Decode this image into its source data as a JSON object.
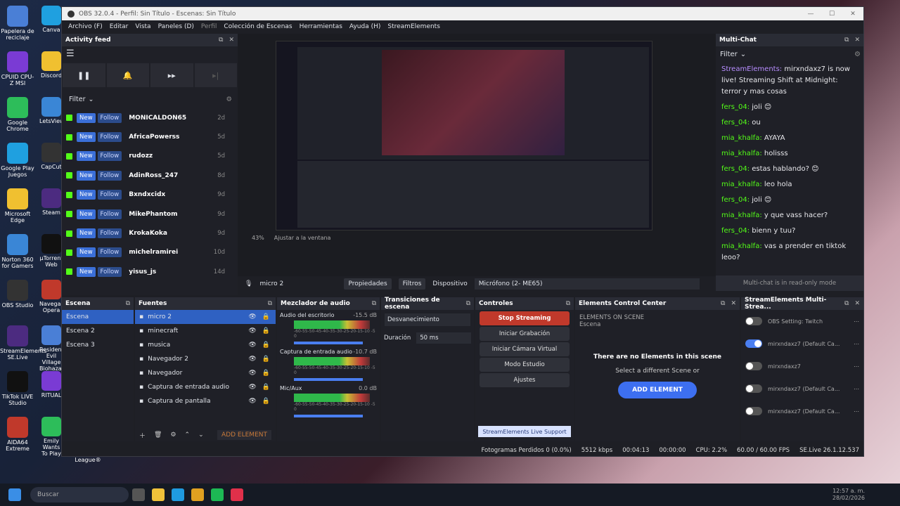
{
  "window": {
    "title": "OBS 32.0.4 - Perfil: Sin Título - Escenas: Sin Título"
  },
  "menu": [
    "Archivo (F)",
    "Editar",
    "Vista",
    "Paneles (D)",
    "Perfil",
    "Colección de Escenas",
    "Herramientas",
    "Ayuda (H)",
    "StreamElements"
  ],
  "desktop": {
    "left": [
      "Papelera de reciclaje",
      "CPUID CPU-Z MSI",
      "Google Chrome",
      "Google Play Juegos",
      "Microsoft Edge",
      "Norton 360 for Gamers",
      "OBS Studio",
      "StreamElements SE.Live",
      "TikTok LIVE Studio",
      "AIDA64 Extreme"
    ],
    "right": [
      "Canva",
      "Discord",
      "LetsView",
      "CapCut",
      "Steam",
      "µTorrent Web",
      "Navegador Opera",
      "Resident Evil Village Biohazard",
      "RITUAL",
      "Emily Wants To Play"
    ],
    "extra": "League®"
  },
  "activity": {
    "title": "Activity feed",
    "filter": "Filter",
    "new": "New",
    "follow": "Follow",
    "rows": [
      {
        "name": "MONICALDON65",
        "age": "2d"
      },
      {
        "name": "AfricaPowerss",
        "age": "5d"
      },
      {
        "name": "rudozz",
        "age": "5d"
      },
      {
        "name": "AdinRoss_247",
        "age": "8d"
      },
      {
        "name": "Bxndxcidx",
        "age": "9d"
      },
      {
        "name": "MikePhantom",
        "age": "9d"
      },
      {
        "name": "KrokaKoka",
        "age": "9d"
      },
      {
        "name": "michelramirei",
        "age": "10d"
      },
      {
        "name": "yisus_js",
        "age": "14d"
      }
    ]
  },
  "preview": {
    "zoom": "43%",
    "fit": "Ajustar a la ventana"
  },
  "sourcebar": {
    "source": "micro 2",
    "props": "Propiedades",
    "filters": "Filtros",
    "device_label": "Dispositivo",
    "device": "Micrófono (2- ME65)"
  },
  "multichat": {
    "title": "Multi-Chat",
    "filter": "Filter",
    "readonly": "Multi-chat is in read-only mode",
    "messages": [
      {
        "user": "StreamElements:",
        "text": " mirxndaxz7 is now live! Streaming Shift at Midnight: terror y mas cosas"
      },
      {
        "user": "fers_04:",
        "text": " joli 😊"
      },
      {
        "user": "fers_04:",
        "text": " ou"
      },
      {
        "user": "mia_khalfa:",
        "text": " AYAYA"
      },
      {
        "user": "mia_khalfa:",
        "text": " holisss"
      },
      {
        "user": "fers_04:",
        "text": " estas hablando? 😊"
      },
      {
        "user": "mia_khalfa:",
        "text": " leo hola"
      },
      {
        "user": "fers_04:",
        "text": " joli 😊"
      },
      {
        "user": "mia_khalfa:",
        "text": " y que vass hacer?"
      },
      {
        "user": "fers_04:",
        "text": " bienn y tuu?"
      },
      {
        "user": "mia_khalfa:",
        "text": " vas a prender en tiktok leoo?"
      }
    ]
  },
  "scenes": {
    "title": "Escena",
    "items": [
      "Escena",
      "Escena 2",
      "Escena 3"
    ]
  },
  "sources": {
    "title": "Fuentes",
    "items": [
      "micro 2",
      "minecraft",
      "musica",
      "Navegador 2",
      "Navegador",
      "Captura de entrada audio",
      "Captura de pantalla"
    ],
    "add_element": "ADD ELEMENT"
  },
  "mixer": {
    "title": "Mezclador de audio",
    "channels": [
      {
        "name": "Audio del escritorio",
        "db": "-15.5 dB"
      },
      {
        "name": "Captura de entrada audio",
        "db": "-10.7 dB"
      },
      {
        "name": "Mic/Aux",
        "db": "0.0 dB"
      }
    ],
    "scale": "-60-55-50-45-40-35-30-25-20-15-10 -5 0"
  },
  "transitions": {
    "title": "Transiciones de escena",
    "type": "Desvanecimiento",
    "duration_label": "Duración",
    "duration": "50 ms"
  },
  "controls": {
    "title": "Controles",
    "buttons": [
      "Stop Streaming",
      "Iniciar Grabación",
      "Iniciar Cámara Virtual",
      "Modo Estudio",
      "Ajustes"
    ],
    "support": "StreamElements Live Support"
  },
  "ecc": {
    "title": "Elements Control Center",
    "on_scene": "ELEMENTS ON SCENE",
    "scene": "Escena",
    "empty": "There are no Elements in this scene",
    "hint": "Select a different Scene or",
    "add": "ADD ELEMENT"
  },
  "semc": {
    "title": "StreamElements Multi-Strea...",
    "rows": [
      {
        "name": "OBS Setting: Twitch"
      },
      {
        "name": "mirxndaxz7 (Default Ca..."
      },
      {
        "name": "mirxndaxz7"
      },
      {
        "name": "mirxndaxz7 (Default Ca..."
      },
      {
        "name": "mirxndaxz7 (Default Ca..."
      }
    ]
  },
  "status": {
    "dropped": "Fotogramas Perdidos 0 (0.0%)",
    "kbps": "5512 kbps",
    "live": "00:04:13",
    "rec": "00:00:00",
    "cpu": "CPU: 2.2%",
    "fps": "60.00 / 60.00 FPS",
    "version": "SE.Live 26.1.12.537"
  },
  "taskbar": {
    "search": "Buscar",
    "time": "12:57 a. m.",
    "date": "28/02/2026"
  },
  "colors": {
    "accent": "#3b6fd8",
    "stop": "#c0392b",
    "kick": "#53fc18",
    "panel": "#1f2027"
  }
}
